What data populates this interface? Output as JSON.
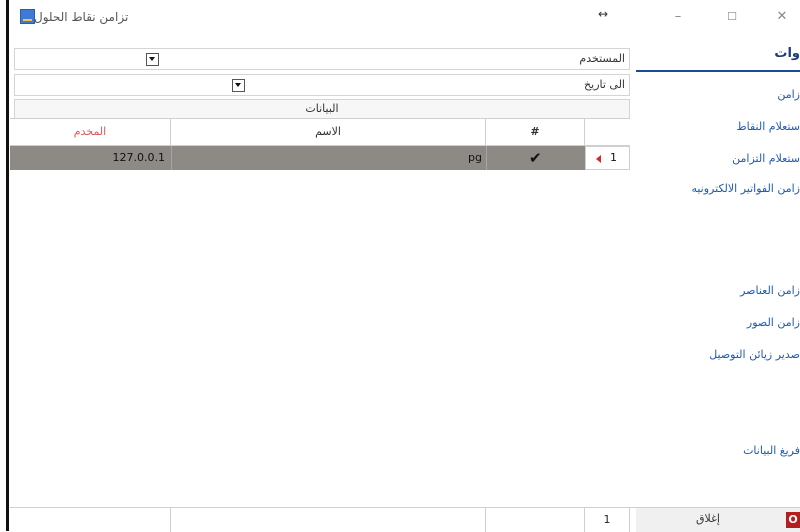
{
  "window": {
    "title": "تزامن نقاط الحلول",
    "resize_glyph": "↔",
    "minimize": "–",
    "maximize": "☐",
    "close": "✕"
  },
  "nav": {
    "header": "وات",
    "items": [
      {
        "label": "زامن"
      },
      {
        "label": "ستعلام النقاط"
      },
      {
        "label": "ستعلام التزامن"
      },
      {
        "label": "زامن الفواتير الالكترونيه"
      },
      {
        "label": "زامن العناصر"
      },
      {
        "label": "زامن الصور"
      },
      {
        "label": "صدير زيائن التوصيل"
      },
      {
        "label": "فريغ البيانات"
      }
    ]
  },
  "filters": {
    "user_label": "المستخدم",
    "to_date_label": "الى تاريخ"
  },
  "section": {
    "title": "البيانات"
  },
  "grid": {
    "columns": {
      "server": "المخدم",
      "name": "الاسم",
      "num": "#"
    },
    "rows": [
      {
        "index": "1",
        "checked": "✔",
        "name": "pg",
        "server": "127.0.0.1"
      }
    ]
  },
  "footer": {
    "count": "1",
    "close_label": "إغلاق",
    "close_badge": "O"
  },
  "colors": {
    "accent": "#1b4a9c",
    "nav_link": "#1f5bb5",
    "selected_row": "#8d8a86",
    "server_header": "#e05a5a",
    "close_badge": "#b51e1e"
  }
}
